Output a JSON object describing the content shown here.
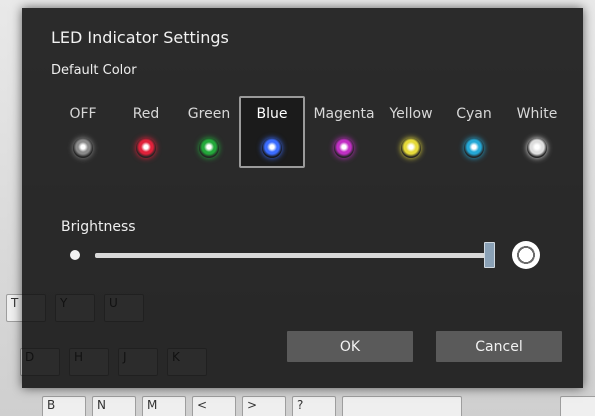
{
  "dialog": {
    "title": "LED Indicator Settings",
    "section_label": "Default Color",
    "brightness_label": "Brightness",
    "brightness_level": 1.0,
    "ok_label": "OK",
    "cancel_label": "Cancel"
  },
  "colors": [
    {
      "label": "OFF",
      "color": "#8a8a8a",
      "selected": false
    },
    {
      "label": "Red",
      "color": "#e0213a",
      "selected": false
    },
    {
      "label": "Green",
      "color": "#23a83a",
      "selected": false
    },
    {
      "label": "Blue",
      "color": "#3b6cff",
      "selected": true
    },
    {
      "label": "Magenta",
      "color": "#c12fc4",
      "selected": false
    },
    {
      "label": "Yellow",
      "color": "#e5da3a",
      "selected": false
    },
    {
      "label": "Cyan",
      "color": "#24a8d6",
      "selected": false
    },
    {
      "label": "White",
      "color": "#dedede",
      "selected": false
    }
  ],
  "background_keys": [
    "T",
    "Y",
    "U",
    "D",
    "H",
    "J",
    "K",
    "B",
    "N",
    "M",
    "<",
    ">",
    "?"
  ]
}
